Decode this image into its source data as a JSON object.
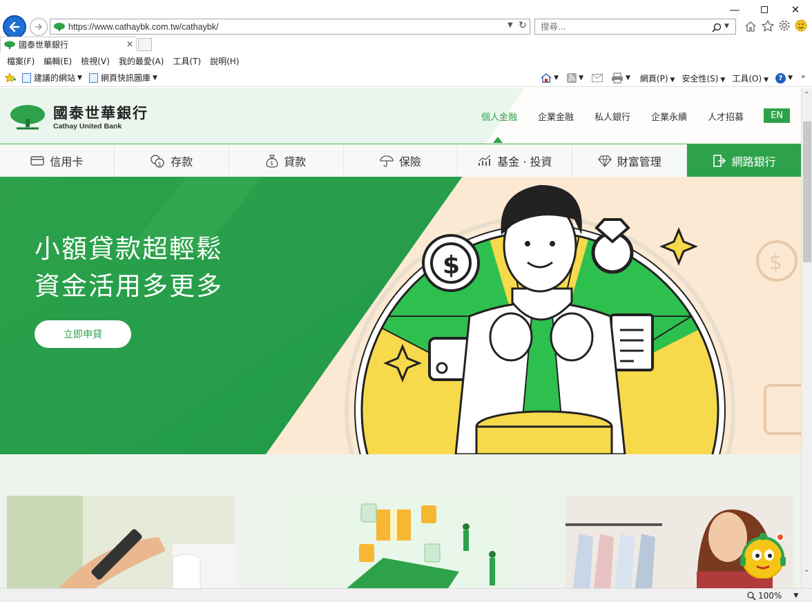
{
  "browser": {
    "url": "https://www.cathaybk.com.tw/cathaybk/",
    "search_placeholder": "搜尋...",
    "tab_title": "國泰世華銀行",
    "menu": [
      "檔案(F)",
      "編輯(E)",
      "檢視(V)",
      "我的最愛(A)",
      "工具(T)",
      "說明(H)"
    ],
    "favorites": [
      "建議的網站",
      "網頁快訊圖庫"
    ],
    "commands": [
      "網頁(P)",
      "安全性(S)",
      "工具(O)"
    ],
    "zoom": "100%"
  },
  "site": {
    "brand_name": "國泰世華銀行",
    "brand_en": "Cathay United Bank",
    "top_links": [
      "個人金融",
      "企業金融",
      "私人銀行",
      "企業永續",
      "人才招募"
    ],
    "active_top_link": "個人金融",
    "lang_button": "EN",
    "nav": [
      "信用卡",
      "存款",
      "貸款",
      "保險",
      "基金 · 投資",
      "財富管理"
    ],
    "online_bank": "網路銀行",
    "hero": {
      "line1": "小額貸款超輕鬆",
      "line2": "資金活用多更多",
      "cta": "立即申貸"
    },
    "brand_green": "#2ea24a"
  }
}
